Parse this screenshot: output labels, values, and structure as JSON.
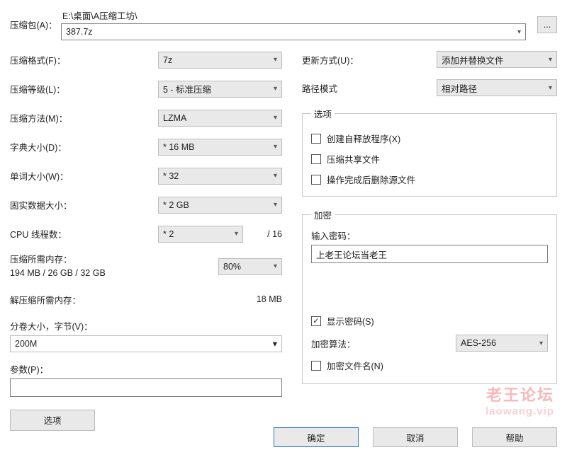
{
  "archive": {
    "label": "压缩包(A)：",
    "path_prefix": "E:\\桌面\\A压缩工坊\\",
    "filename": "387.7z",
    "browse": "..."
  },
  "left": {
    "format": {
      "label": "压缩格式(F)：",
      "value": "7z"
    },
    "level": {
      "label": "压缩等级(L)：",
      "value": "5 - 标准压缩"
    },
    "method": {
      "label": "压缩方法(M)：",
      "value": "LZMA"
    },
    "dict": {
      "label": "字典大小(D)：",
      "value": "* 16 MB"
    },
    "word": {
      "label": "单词大小(W)：",
      "value": "* 32"
    },
    "solid": {
      "label": "固实数据大小：",
      "value": "* 2 GB"
    },
    "threads": {
      "label": "CPU 线程数：",
      "value": "* 2",
      "total": "/ 16"
    },
    "mem_comp": {
      "label": "压缩所需内存：",
      "value": "194 MB / 26 GB / 32 GB",
      "pct": "80%"
    },
    "mem_decomp": {
      "label": "解压缩所需内存：",
      "value": "18 MB"
    },
    "split": {
      "label": "分卷大小，字节(V)：",
      "value": "200M"
    },
    "params": {
      "label": "参数(P)：",
      "value": ""
    },
    "options_btn": "选项"
  },
  "right": {
    "update": {
      "label": "更新方式(U)：",
      "value": "添加并替换文件"
    },
    "path": {
      "label": "路径模式",
      "value": "相对路径"
    },
    "options": {
      "legend": "选项",
      "sfx": "创建自释放程序(X)",
      "share": "压缩共享文件",
      "del": "操作完成后删除源文件"
    },
    "encrypt": {
      "legend": "加密",
      "pw_label": "输入密码：",
      "pw_value": "上老王论坛当老王",
      "show_pw": "显示密码(S)",
      "algo_label": "加密算法：",
      "algo_value": "AES-256",
      "enc_names": "加密文件名(N)"
    }
  },
  "buttons": {
    "ok": "确定",
    "cancel": "取消",
    "help": "帮助"
  },
  "watermark": {
    "l1": "老王论坛",
    "l2": "laowang.vip"
  }
}
